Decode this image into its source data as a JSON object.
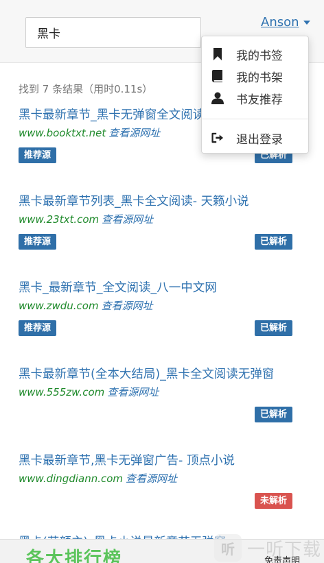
{
  "search": {
    "query": "黑卡"
  },
  "user": {
    "name": "Anson"
  },
  "results_meta": "找到 7 条结果（用时0.11s）",
  "results": [
    {
      "title": "黑卡最新章节_黑卡无弹窗全文阅读",
      "domain": "www.booktxt.net",
      "source_link": "查看源网址",
      "recommended": "推荐源",
      "status": "已解析"
    },
    {
      "title": "黑卡最新章节列表_黑卡全文阅读- 天籁小说",
      "domain": "www.23txt.com",
      "source_link": "查看源网址",
      "recommended": "推荐源",
      "status": "已解析"
    },
    {
      "title": "黑卡_最新章节_全文阅读_八一中文网",
      "domain": "www.zwdu.com",
      "source_link": "查看源网址",
      "recommended": "推荐源",
      "status": "已解析"
    },
    {
      "title": "黑卡最新章节(全本大结局)_黑卡全文阅读无弹窗",
      "domain": "www.555zw.com",
      "source_link": "查看源网址",
      "recommended": "",
      "status": "已解析"
    },
    {
      "title": "黑卡最新章节,黑卡无弹窗广告- 顶点小说",
      "domain": "www.dingdiann.com",
      "source_link": "查看源网址",
      "recommended": "",
      "status": "未解析"
    }
  ],
  "peek_title": "黑卡(花颜主)_黑卡小说最新章节无弹窗_",
  "menu": {
    "items": [
      {
        "label": "我的书签",
        "icon": "bookmark-icon"
      },
      {
        "label": "我的书架",
        "icon": "book-icon"
      },
      {
        "label": "书友推荐",
        "icon": "user-icon"
      },
      {
        "label": "退出登录",
        "icon": "logout-icon"
      }
    ]
  },
  "footer": {
    "ranking": "各大排行榜",
    "disclaimer": "免责声明"
  },
  "watermark": {
    "text": "一听下载"
  },
  "colors": {
    "link": "#2f72b0",
    "domain": "#1f8a2b",
    "badge_blue": "#2f6fa8",
    "badge_red": "#d9534f",
    "ranking_green": "#5bc45b"
  }
}
